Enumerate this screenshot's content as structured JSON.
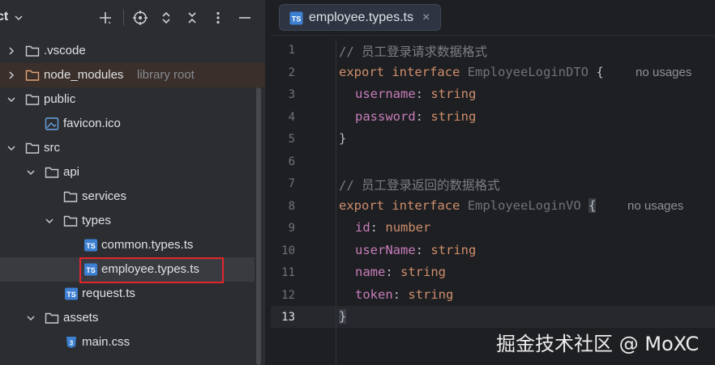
{
  "project_panel": {
    "title": "ct",
    "tree": [
      {
        "label": ".vscode",
        "hint": ""
      },
      {
        "label": "node_modules",
        "hint": "library root"
      },
      {
        "label": "public",
        "hint": ""
      },
      {
        "label": "favicon.ico",
        "hint": ""
      },
      {
        "label": "src",
        "hint": ""
      },
      {
        "label": "api",
        "hint": ""
      },
      {
        "label": "services",
        "hint": ""
      },
      {
        "label": "types",
        "hint": ""
      },
      {
        "label": "common.types.ts",
        "hint": ""
      },
      {
        "label": "employee.types.ts",
        "hint": ""
      },
      {
        "label": "request.ts",
        "hint": ""
      },
      {
        "label": "assets",
        "hint": ""
      },
      {
        "label": "main.css",
        "hint": ""
      }
    ]
  },
  "editor": {
    "tab": {
      "badge": "TS",
      "label": "employee.types.ts",
      "close": "×"
    },
    "line_numbers": [
      "1",
      "2",
      "3",
      "4",
      "5",
      "6",
      "7",
      "8",
      "9",
      "10",
      "11",
      "12",
      "13"
    ],
    "code": {
      "l1_comment": "// 员工登录请求数据格式",
      "l2_export": "export",
      "l2_interface": "interface",
      "l2_name": "EmployeeLoginDTO",
      "l2_brace": "{",
      "l2_usage": "no usages",
      "l3_prop": "username",
      "l3_type": "string",
      "l4_prop": "password",
      "l4_type": "string",
      "l5_close": "}",
      "l7_comment": "// 员工登录返回的数据格式",
      "l8_export": "export",
      "l8_interface": "interface",
      "l8_name": "EmployeeLoginVO",
      "l8_brace": "{",
      "l8_usage": "no usages",
      "l9_prop": "id",
      "l9_type": "number",
      "l10_prop": "userName",
      "l10_type": "string",
      "l11_prop": "name",
      "l11_type": "string",
      "l12_prop": "token",
      "l12_type": "string",
      "l13_close": "}",
      "colon": ":"
    }
  },
  "watermark": "掘金技术社区 @ MoXC",
  "colors": {
    "keyword": "#cf8e6d",
    "property": "#c77dbb",
    "comment": "#7a7e85",
    "highlight_box": "#e3262d",
    "panel_bg": "#2b2d30",
    "editor_bg": "#1e1f22"
  },
  "icons": [
    "chevron-down-icon",
    "plus-icon",
    "crosshair-icon",
    "expand-icon",
    "collapse-icon",
    "more-icon",
    "minimize-icon",
    "folder-icon",
    "image-file-icon",
    "ts-file-icon",
    "css-file-icon",
    "close-icon"
  ]
}
